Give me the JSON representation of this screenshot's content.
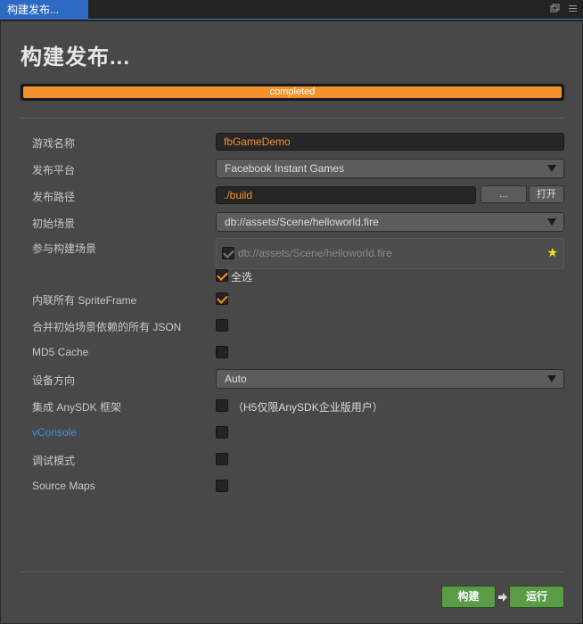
{
  "tab": {
    "title": "构建发布..."
  },
  "page_title": "构建发布...",
  "progress": {
    "percent": 100,
    "label": "completed",
    "color": "#f3922a"
  },
  "fields": {
    "game_name": {
      "label": "游戏名称",
      "value": "fbGameDemo"
    },
    "platform": {
      "label": "发布平台",
      "value": "Facebook Instant Games"
    },
    "build_path": {
      "label": "发布路径",
      "value": "./build",
      "browse_label": "...",
      "open_label": "打开"
    },
    "start_scene": {
      "label": "初始场景",
      "value": "db://assets/Scene/helloworld.fire"
    },
    "included_scenes": {
      "label": "参与构建场景",
      "scenes": [
        "db://assets/Scene/helloworld.fire"
      ],
      "select_all_label": "全选"
    },
    "inline_spriteframe": {
      "label": "内联所有 SpriteFrame",
      "checked": true
    },
    "merge_json": {
      "label": "合并初始场景依赖的所有 JSON",
      "checked": false
    },
    "md5_cache": {
      "label": "MD5 Cache",
      "checked": false
    },
    "orientation": {
      "label": "设备方向",
      "value": "Auto"
    },
    "anysdk": {
      "label": "集成 AnySDK 框架",
      "checked": false,
      "note": "（H5仅限AnySDK企业版用户）"
    },
    "vconsole": {
      "label": "vConsole",
      "checked": false
    },
    "debug_mode": {
      "label": "调试模式",
      "checked": false
    },
    "source_maps": {
      "label": "Source Maps",
      "checked": false
    }
  },
  "actions": {
    "build_label": "构建",
    "run_label": "运行"
  },
  "colors": {
    "accent": "#f3922a",
    "action_green": "#5a9b46",
    "link_blue": "#3d90e6",
    "tab_blue": "#2d6bc3"
  }
}
